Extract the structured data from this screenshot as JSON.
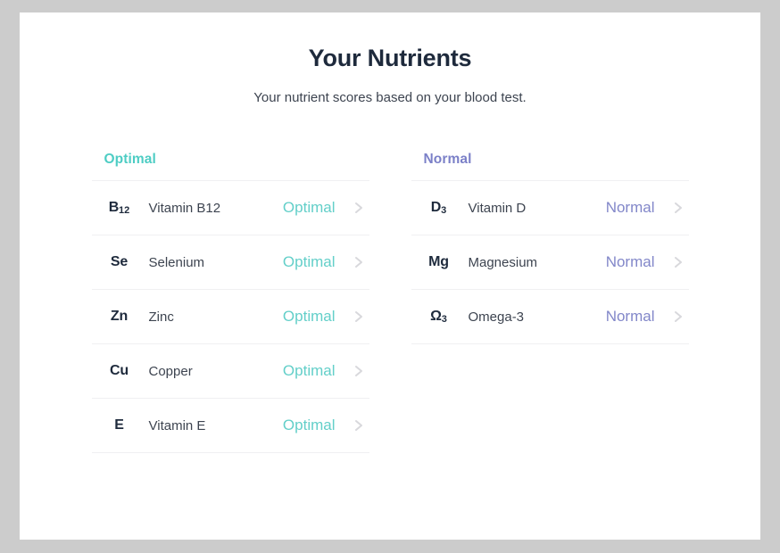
{
  "header": {
    "title": "Your Nutrients",
    "subtitle": "Your nutrient scores based on your blood test."
  },
  "colors": {
    "page_background": "#cccccc",
    "card_background": "#ffffff",
    "title": "#1e2a3c",
    "optimal_header": "#4ecdc4",
    "optimal_status": "#63cfc9",
    "normal_header": "#7b80c8",
    "normal_status": "#8287c9",
    "divider": "#f0f0f2",
    "chevron": "#d8d8dc"
  },
  "columns": [
    {
      "heading": "Optimal",
      "heading_class": "optimal",
      "status_class": "optimal",
      "rows": [
        {
          "symbol": "B",
          "symbol_sub": "12",
          "name": "Vitamin B12",
          "status": "Optimal",
          "chevron": "chevron-right-icon"
        },
        {
          "symbol": "Se",
          "symbol_sub": "",
          "name": "Selenium",
          "status": "Optimal",
          "chevron": "chevron-right-icon"
        },
        {
          "symbol": "Zn",
          "symbol_sub": "",
          "name": "Zinc",
          "status": "Optimal",
          "chevron": "chevron-right-icon"
        },
        {
          "symbol": "Cu",
          "symbol_sub": "",
          "name": "Copper",
          "status": "Optimal",
          "chevron": "chevron-right-icon"
        },
        {
          "symbol": "E",
          "symbol_sub": "",
          "name": "Vitamin E",
          "status": "Optimal",
          "chevron": "chevron-right-icon"
        }
      ]
    },
    {
      "heading": "Normal",
      "heading_class": "normal",
      "status_class": "normal",
      "rows": [
        {
          "symbol": "D",
          "symbol_sub": "3",
          "name": "Vitamin D",
          "status": "Normal",
          "chevron": "chevron-right-icon"
        },
        {
          "symbol": "Mg",
          "symbol_sub": "",
          "name": "Magnesium",
          "status": "Normal",
          "chevron": "chevron-right-icon"
        },
        {
          "symbol": "Ω",
          "symbol_sub": "3",
          "name": "Omega-3",
          "status": "Normal",
          "chevron": "chevron-right-icon"
        }
      ]
    }
  ]
}
